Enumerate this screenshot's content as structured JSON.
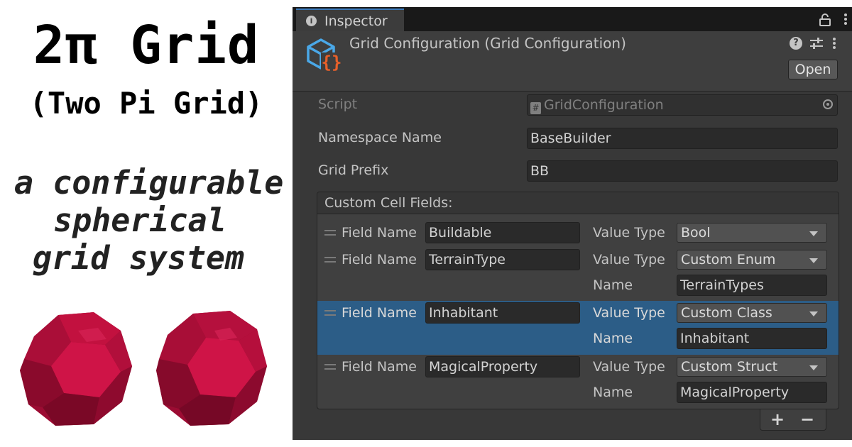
{
  "promo": {
    "title": "2π Grid",
    "subtitle": "(Two Pi Grid)",
    "tagline": [
      "a configurable",
      "spherical",
      "grid system"
    ]
  },
  "inspector": {
    "tab_label": "Inspector",
    "tab_icon": "info-icon",
    "component_title": "Grid Configuration (Grid Configuration)",
    "help_glyph": "?",
    "open_button": "Open",
    "properties": {
      "script_label": "Script",
      "script_value": "GridConfiguration",
      "namespace_label": "Namespace Name",
      "namespace_value": "BaseBuilder",
      "prefix_label": "Grid Prefix",
      "prefix_value": "BB"
    },
    "list": {
      "header": "Custom Cell Fields:",
      "field_name_label": "Field Name",
      "value_type_label": "Value Type",
      "name_label": "Name",
      "items": [
        {
          "field_name": "Buildable",
          "value_type": "Bool",
          "name": null,
          "selected": false
        },
        {
          "field_name": "TerrainType",
          "value_type": "Custom Enum",
          "name": "TerrainTypes",
          "selected": false
        },
        {
          "field_name": "Inhabitant",
          "value_type": "Custom Class",
          "name": "Inhabitant",
          "selected": true
        },
        {
          "field_name": "MagicalProperty",
          "value_type": "Custom Struct",
          "name": "MagicalProperty",
          "selected": false
        }
      ],
      "add_button": "+",
      "remove_button": "−"
    }
  },
  "colors": {
    "panel_bg": "#383838",
    "selected_row": "#2c5d87",
    "tab_accent": "#3a79bb",
    "sphere_color": "#c0103e",
    "script_icon_blue": "#4aa8e8",
    "script_icon_orange": "#e8602a"
  }
}
